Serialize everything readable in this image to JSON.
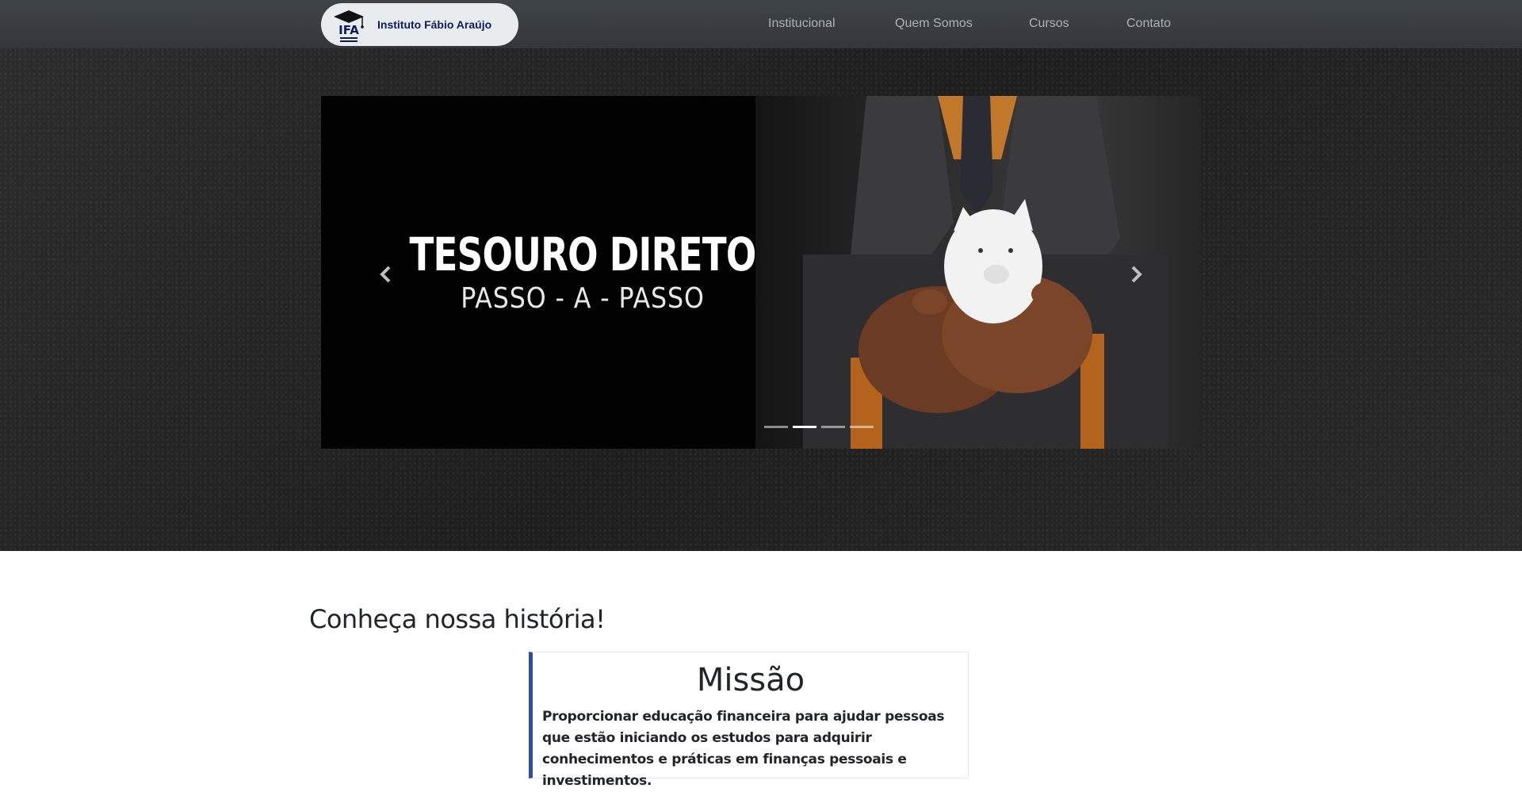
{
  "brand": {
    "logo_text": "IFA",
    "name": "Instituto Fábio Araújo"
  },
  "nav": {
    "items": [
      {
        "label": "Institucional"
      },
      {
        "label": "Quem Somos"
      },
      {
        "label": "Cursos"
      },
      {
        "label": "Contato"
      }
    ]
  },
  "carousel": {
    "slide": {
      "title": "TESOURO DIRETO",
      "subtitle": "PASSO - A - PASSO"
    },
    "indicator_count": 4,
    "active_index": 1
  },
  "section": {
    "title": "Conheça nossa história!"
  },
  "mission": {
    "title": "Missão",
    "text": "Proporcionar educação financeira para ajudar pessoas que estão iniciando os estudos para adquirir conhecimentos e práticas em finanças pessoais e investimentos."
  },
  "colors": {
    "navbar": "#3a3e42",
    "brand_text": "#0e1a5a",
    "mission_accent": "#2e4d9e"
  }
}
